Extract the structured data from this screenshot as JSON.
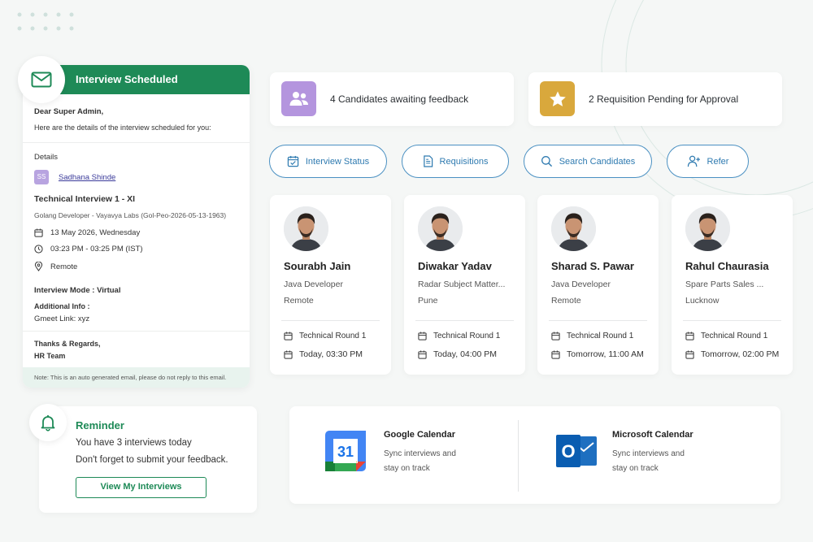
{
  "email": {
    "header_title": "Interview Scheduled",
    "greeting": "Dear Super Admin,",
    "intro": "Here are the details of the interview scheduled for you:",
    "details_label": "Details",
    "candidate_initials": "SS",
    "candidate_name": "Sadhana Shinde",
    "interview_title": "Technical Interview 1 - XI",
    "job_line": "Golang Developer - Vayavya Labs (Gol-Peo-2026-05-13-1963)",
    "date": "13 May 2026, Wednesday",
    "time": "03:23 PM - 03:25 PM (IST)",
    "location": "Remote",
    "mode": "Interview Mode : Virtual",
    "additional_label": "Additional Info :",
    "additional_value": "Gmeet Link: xyz",
    "thanks": "Thanks & Regards,",
    "team": "HR Team",
    "note": "Note: This is an auto generated email, please do not reply to this email."
  },
  "stats": [
    {
      "text": "4 Candidates awaiting feedback",
      "icon": "users-icon",
      "color": "#b495de"
    },
    {
      "text": "2 Requisition Pending for Approval",
      "icon": "star-icon",
      "color": "#d9a83c"
    }
  ],
  "actions": [
    {
      "label": "Interview Status",
      "icon": "calendar-check-icon"
    },
    {
      "label": "Requisitions",
      "icon": "document-icon"
    },
    {
      "label": "Search Candidates",
      "icon": "search-icon"
    },
    {
      "label": "Refer",
      "icon": "add-user-icon"
    }
  ],
  "candidates": [
    {
      "name": "Sourabh Jain",
      "role": "Java Developer",
      "location": "Remote",
      "round": "Technical Round 1",
      "when": "Today, 03:30 PM"
    },
    {
      "name": "Diwakar Yadav",
      "role": "Radar Subject Matter...",
      "location": "Pune",
      "round": "Technical Round 1",
      "when": "Today, 04:00 PM"
    },
    {
      "name": "Sharad S. Pawar",
      "role": "Java Developer",
      "location": "Remote",
      "round": "Technical Round 1",
      "when": "Tomorrow, 11:00 AM"
    },
    {
      "name": "Rahul Chaurasia",
      "role": "Spare Parts Sales ...",
      "location": "Lucknow",
      "round": "Technical Round 1",
      "when": "Tomorrow, 02:00 PM"
    }
  ],
  "reminder": {
    "title": "Reminder",
    "line1": "You have 3 interviews today",
    "line2": "Don't forget to submit your feedback.",
    "button": "View My Interviews"
  },
  "calendars": {
    "google": {
      "title": "Google Calendar",
      "line1": "Sync interviews and",
      "line2": "stay on track",
      "day": "31"
    },
    "microsoft": {
      "title": "Microsoft Calendar",
      "line1": "Sync interviews and",
      "line2": "stay on track",
      "letter": "O"
    }
  },
  "colors": {
    "brand_green": "#1e8a57",
    "accent_blue": "#2e7ab0"
  }
}
